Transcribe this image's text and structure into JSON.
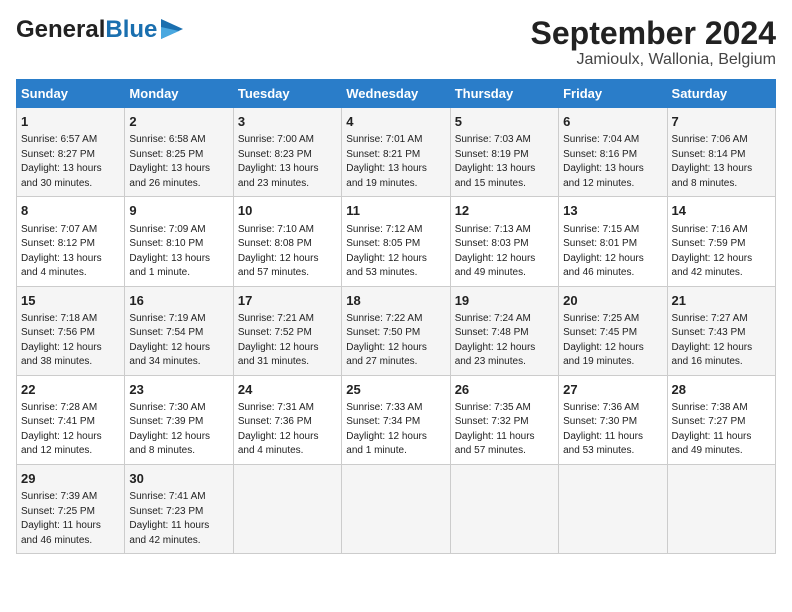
{
  "header": {
    "logo_line1": "General",
    "logo_line2": "Blue",
    "title": "September 2024",
    "subtitle": "Jamioulx, Wallonia, Belgium"
  },
  "days_of_week": [
    "Sunday",
    "Monday",
    "Tuesday",
    "Wednesday",
    "Thursday",
    "Friday",
    "Saturday"
  ],
  "weeks": [
    [
      {
        "day": "1",
        "lines": [
          "Sunrise: 6:57 AM",
          "Sunset: 8:27 PM",
          "Daylight: 13 hours",
          "and 30 minutes."
        ]
      },
      {
        "day": "2",
        "lines": [
          "Sunrise: 6:58 AM",
          "Sunset: 8:25 PM",
          "Daylight: 13 hours",
          "and 26 minutes."
        ]
      },
      {
        "day": "3",
        "lines": [
          "Sunrise: 7:00 AM",
          "Sunset: 8:23 PM",
          "Daylight: 13 hours",
          "and 23 minutes."
        ]
      },
      {
        "day": "4",
        "lines": [
          "Sunrise: 7:01 AM",
          "Sunset: 8:21 PM",
          "Daylight: 13 hours",
          "and 19 minutes."
        ]
      },
      {
        "day": "5",
        "lines": [
          "Sunrise: 7:03 AM",
          "Sunset: 8:19 PM",
          "Daylight: 13 hours",
          "and 15 minutes."
        ]
      },
      {
        "day": "6",
        "lines": [
          "Sunrise: 7:04 AM",
          "Sunset: 8:16 PM",
          "Daylight: 13 hours",
          "and 12 minutes."
        ]
      },
      {
        "day": "7",
        "lines": [
          "Sunrise: 7:06 AM",
          "Sunset: 8:14 PM",
          "Daylight: 13 hours",
          "and 8 minutes."
        ]
      }
    ],
    [
      {
        "day": "8",
        "lines": [
          "Sunrise: 7:07 AM",
          "Sunset: 8:12 PM",
          "Daylight: 13 hours",
          "and 4 minutes."
        ]
      },
      {
        "day": "9",
        "lines": [
          "Sunrise: 7:09 AM",
          "Sunset: 8:10 PM",
          "Daylight: 13 hours",
          "and 1 minute."
        ]
      },
      {
        "day": "10",
        "lines": [
          "Sunrise: 7:10 AM",
          "Sunset: 8:08 PM",
          "Daylight: 12 hours",
          "and 57 minutes."
        ]
      },
      {
        "day": "11",
        "lines": [
          "Sunrise: 7:12 AM",
          "Sunset: 8:05 PM",
          "Daylight: 12 hours",
          "and 53 minutes."
        ]
      },
      {
        "day": "12",
        "lines": [
          "Sunrise: 7:13 AM",
          "Sunset: 8:03 PM",
          "Daylight: 12 hours",
          "and 49 minutes."
        ]
      },
      {
        "day": "13",
        "lines": [
          "Sunrise: 7:15 AM",
          "Sunset: 8:01 PM",
          "Daylight: 12 hours",
          "and 46 minutes."
        ]
      },
      {
        "day": "14",
        "lines": [
          "Sunrise: 7:16 AM",
          "Sunset: 7:59 PM",
          "Daylight: 12 hours",
          "and 42 minutes."
        ]
      }
    ],
    [
      {
        "day": "15",
        "lines": [
          "Sunrise: 7:18 AM",
          "Sunset: 7:56 PM",
          "Daylight: 12 hours",
          "and 38 minutes."
        ]
      },
      {
        "day": "16",
        "lines": [
          "Sunrise: 7:19 AM",
          "Sunset: 7:54 PM",
          "Daylight: 12 hours",
          "and 34 minutes."
        ]
      },
      {
        "day": "17",
        "lines": [
          "Sunrise: 7:21 AM",
          "Sunset: 7:52 PM",
          "Daylight: 12 hours",
          "and 31 minutes."
        ]
      },
      {
        "day": "18",
        "lines": [
          "Sunrise: 7:22 AM",
          "Sunset: 7:50 PM",
          "Daylight: 12 hours",
          "and 27 minutes."
        ]
      },
      {
        "day": "19",
        "lines": [
          "Sunrise: 7:24 AM",
          "Sunset: 7:48 PM",
          "Daylight: 12 hours",
          "and 23 minutes."
        ]
      },
      {
        "day": "20",
        "lines": [
          "Sunrise: 7:25 AM",
          "Sunset: 7:45 PM",
          "Daylight: 12 hours",
          "and 19 minutes."
        ]
      },
      {
        "day": "21",
        "lines": [
          "Sunrise: 7:27 AM",
          "Sunset: 7:43 PM",
          "Daylight: 12 hours",
          "and 16 minutes."
        ]
      }
    ],
    [
      {
        "day": "22",
        "lines": [
          "Sunrise: 7:28 AM",
          "Sunset: 7:41 PM",
          "Daylight: 12 hours",
          "and 12 minutes."
        ]
      },
      {
        "day": "23",
        "lines": [
          "Sunrise: 7:30 AM",
          "Sunset: 7:39 PM",
          "Daylight: 12 hours",
          "and 8 minutes."
        ]
      },
      {
        "day": "24",
        "lines": [
          "Sunrise: 7:31 AM",
          "Sunset: 7:36 PM",
          "Daylight: 12 hours",
          "and 4 minutes."
        ]
      },
      {
        "day": "25",
        "lines": [
          "Sunrise: 7:33 AM",
          "Sunset: 7:34 PM",
          "Daylight: 12 hours",
          "and 1 minute."
        ]
      },
      {
        "day": "26",
        "lines": [
          "Sunrise: 7:35 AM",
          "Sunset: 7:32 PM",
          "Daylight: 11 hours",
          "and 57 minutes."
        ]
      },
      {
        "day": "27",
        "lines": [
          "Sunrise: 7:36 AM",
          "Sunset: 7:30 PM",
          "Daylight: 11 hours",
          "and 53 minutes."
        ]
      },
      {
        "day": "28",
        "lines": [
          "Sunrise: 7:38 AM",
          "Sunset: 7:27 PM",
          "Daylight: 11 hours",
          "and 49 minutes."
        ]
      }
    ],
    [
      {
        "day": "29",
        "lines": [
          "Sunrise: 7:39 AM",
          "Sunset: 7:25 PM",
          "Daylight: 11 hours",
          "and 46 minutes."
        ]
      },
      {
        "day": "30",
        "lines": [
          "Sunrise: 7:41 AM",
          "Sunset: 7:23 PM",
          "Daylight: 11 hours",
          "and 42 minutes."
        ]
      },
      {
        "day": "",
        "lines": []
      },
      {
        "day": "",
        "lines": []
      },
      {
        "day": "",
        "lines": []
      },
      {
        "day": "",
        "lines": []
      },
      {
        "day": "",
        "lines": []
      }
    ]
  ]
}
